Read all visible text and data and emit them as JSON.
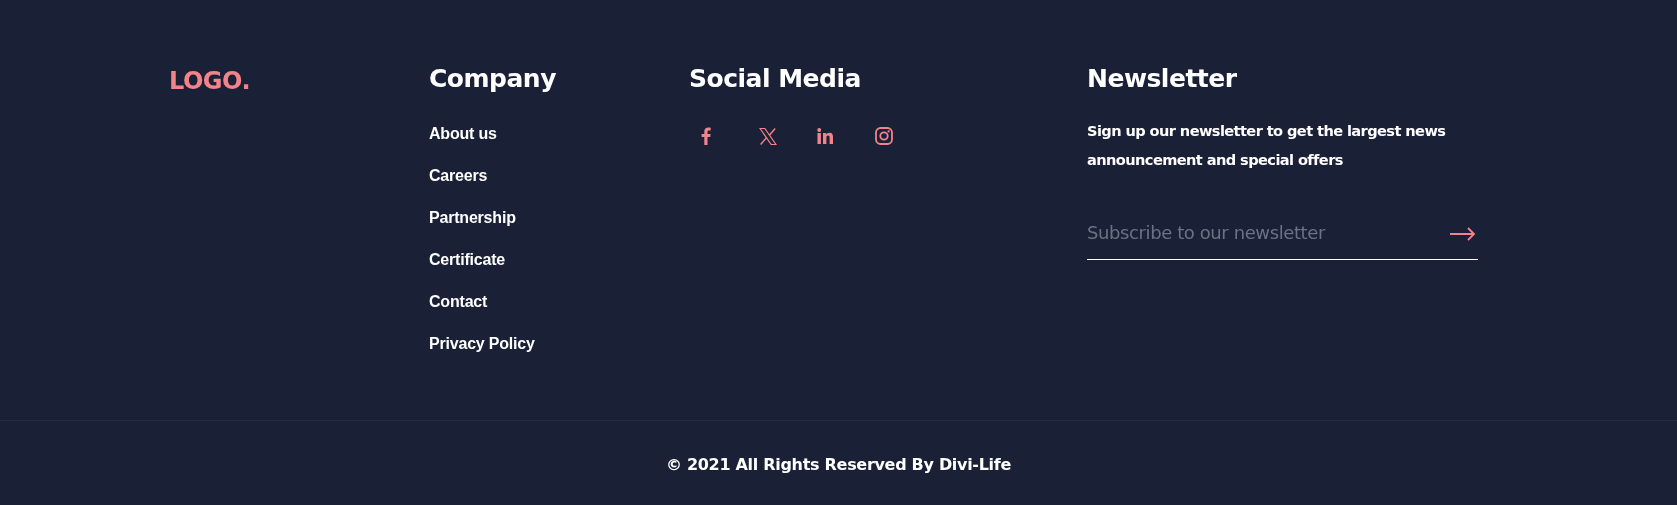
{
  "logo": "LOGO.",
  "company": {
    "title": "Company",
    "links": [
      "About us",
      "Careers",
      "Partnership",
      "Certificate",
      "Contact",
      "Privacy Policy"
    ]
  },
  "social": {
    "title": "Social Media",
    "links": [
      {
        "kind": "facebook"
      },
      {
        "kind": "x"
      },
      {
        "kind": "linkedin"
      },
      {
        "kind": "instagram"
      }
    ]
  },
  "newsletter": {
    "title": "Newsletter",
    "text": "Sign up our newsletter to get the largest news announcement and special offers",
    "placeholder": "Subscribe to our newsletter"
  },
  "copyright": "© 2021 All Rights Reserved By Divi-Life"
}
